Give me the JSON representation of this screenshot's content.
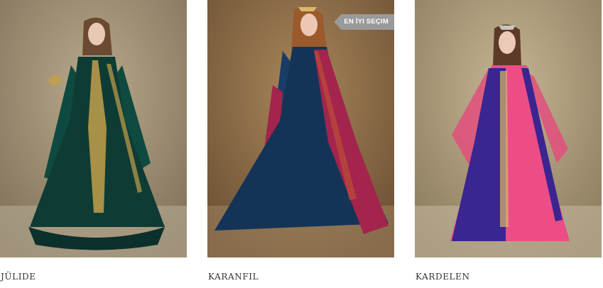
{
  "products": [
    {
      "name": "JÜLIDE",
      "image_desc": "emerald-green-gold-embroidered-gown",
      "colors": {
        "dress": "#0f3b35",
        "accent": "#c2a04a",
        "sleeve": "#12473f"
      }
    },
    {
      "name": "KARANFIL",
      "image_desc": "navy-blue-and-magenta-gown",
      "badge": "EN İYI SEÇIM",
      "colors": {
        "dress": "#143457",
        "accent": "#a3244c",
        "sleeve": "#1a3d66"
      }
    },
    {
      "name": "KARDELEN",
      "image_desc": "purple-and-pink-gown",
      "colors": {
        "dress": "#ec4d86",
        "accent": "#3b2590",
        "sleeve": "#e24f7d"
      }
    }
  ]
}
